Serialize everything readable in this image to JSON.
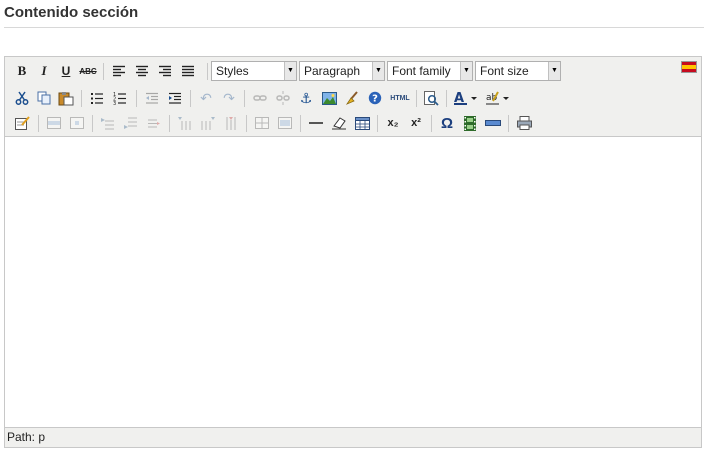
{
  "section": {
    "title": "Contenido sección"
  },
  "toolbar": {
    "format_select_placeholder": "Styles",
    "block_select_value": "Paragraph",
    "font_family_placeholder": "Font family",
    "font_size_placeholder": "Font size",
    "html_button_label": "HTML",
    "subscript_label": "x₂",
    "superscript_label": "x²",
    "charmap_label": "Ω"
  },
  "language_flag": {
    "country": "es",
    "colors": [
      "#c60b1e",
      "#ffc400"
    ]
  },
  "statusbar": {
    "path_label": "Path: p"
  }
}
